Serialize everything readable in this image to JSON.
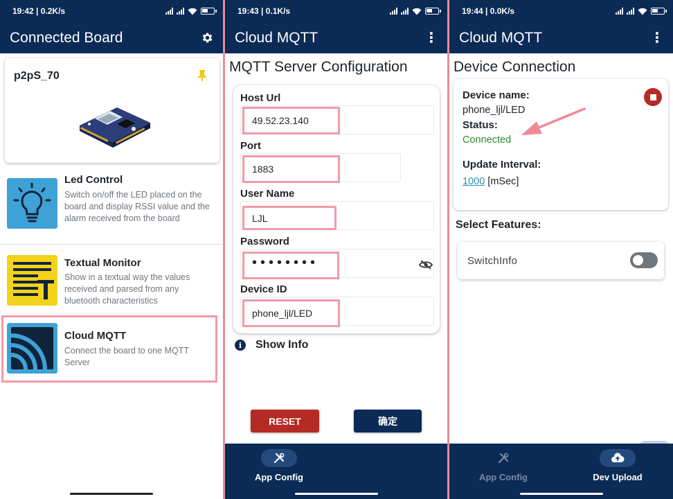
{
  "panels": [
    {
      "status": {
        "time": "19:42 | 0.2K/s"
      },
      "app_bar": {
        "title": "Connected Board",
        "settings_icon": "gear-icon"
      },
      "board": {
        "name": "p2pS_70",
        "pin_icon": "pin-icon"
      },
      "features": [
        {
          "title": "Led Control",
          "description": "Switch on/off the LED placed on the board and display RSSI value and the alarm received from the board",
          "icon": "lightbulb-icon"
        },
        {
          "title": "Textual Monitor",
          "description": "Show in a textual way the values received and parsed from any bluetooth characteristics",
          "icon": "text-lines-icon"
        },
        {
          "title": "Cloud MQTT",
          "description": "Connect the board to one MQTT Server",
          "icon": "signal-waves-icon",
          "highlighted": true
        }
      ]
    },
    {
      "status": {
        "time": "19:43 | 0.1K/s"
      },
      "app_bar": {
        "title": "Cloud MQTT",
        "menu_icon": "more-vertical-icon"
      },
      "section_title": "MQTT Server Configuration",
      "fields": {
        "host": {
          "label": "Host Url",
          "value": "49.52.23.140"
        },
        "port": {
          "label": "Port",
          "value": "1883"
        },
        "user": {
          "label": "User Name",
          "value": "LJL"
        },
        "password": {
          "label": "Password",
          "value": "••••••••"
        },
        "device_id": {
          "label": "Device ID",
          "value": "phone_ljl/LED"
        }
      },
      "show_info": "Show Info",
      "buttons": {
        "reset": "RESET",
        "ok": "确定"
      },
      "nav": {
        "app_config": "App Config"
      }
    },
    {
      "status": {
        "time": "19:44 | 0.0K/s"
      },
      "app_bar": {
        "title": "Cloud MQTT",
        "menu_icon": "more-vertical-icon"
      },
      "section_title": "Device Connection",
      "device": {
        "name_label": "Device name:",
        "name_value": "phone_ljl/LED",
        "status_label": "Status:",
        "status_value": "Connected",
        "interval_label": "Update Interval:",
        "interval_value": "1000",
        "interval_unit": "[mSec]"
      },
      "select_features": "Select Features:",
      "switch_info": {
        "label": "SwitchInfo",
        "on": false
      },
      "nav": {
        "app_config": "App Config",
        "dev_upload": "Dev Upload"
      }
    }
  ],
  "colors": {
    "header": "#0b2a55",
    "highlight": "#ef9ba5",
    "connected": "#2e8b2e",
    "danger": "#b52a24",
    "link": "#2b8fb5"
  }
}
